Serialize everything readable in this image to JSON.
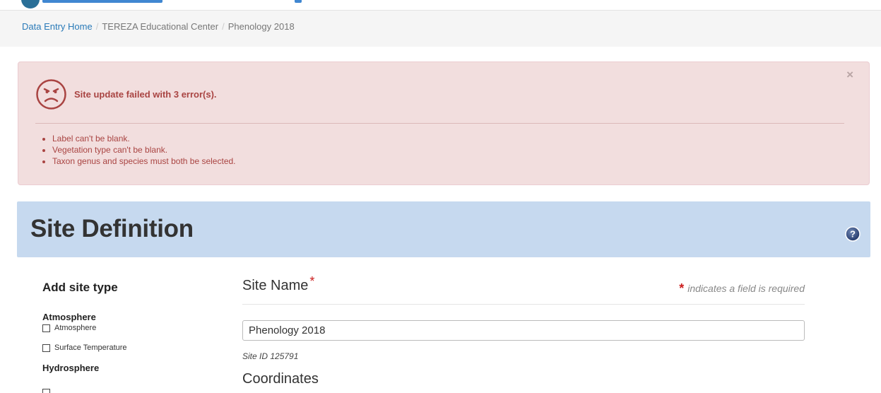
{
  "breadcrumb": {
    "home": "Data Entry Home",
    "center": "TEREZA Educational Center",
    "current": "Phenology 2018"
  },
  "alert": {
    "close": "×",
    "title": "Site update failed with 3 error(s).",
    "errors": [
      "Label can't be blank.",
      "Vegetation type can't be blank.",
      "Taxon genus and species must both be selected."
    ],
    "color": "#a94442"
  },
  "section": {
    "title": "Site Definition",
    "help": "?"
  },
  "sidebar": {
    "title": "Add site type",
    "groups": [
      {
        "title": "Atmosphere",
        "items": [
          "Atmosphere",
          "Surface Temperature"
        ]
      },
      {
        "title": "Hydrosphere"
      }
    ]
  },
  "form": {
    "site_name_label": "Site Name",
    "required_marker": "*",
    "required_note": "indicates a field is required",
    "site_name_value": "Phenology 2018",
    "site_id": "Site ID 125791",
    "coordinates_label": "Coordinates"
  },
  "colors": {
    "header_bg": "#c6d9ef",
    "alert_bg": "#f2dede",
    "link": "#2a7ab8",
    "required": "#cc1f1f"
  }
}
